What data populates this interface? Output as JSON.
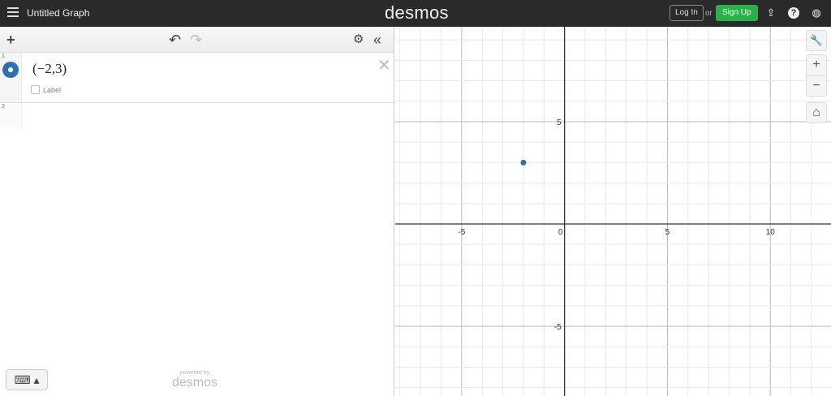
{
  "header": {
    "title": "Untitled Graph",
    "logo": "desmos",
    "login": "Log In",
    "or": "or",
    "signup": "Sign Up",
    "icons": [
      "share-icon",
      "help-icon",
      "globe-icon"
    ]
  },
  "toolbar": {
    "add": "+",
    "undo": "↶",
    "redo": "↷",
    "settings": "⚙",
    "collapse": "«"
  },
  "expressions": [
    {
      "num": "1",
      "latex": "(−2,3)",
      "label": "Label",
      "color": "#2d70b3"
    },
    {
      "num": "2",
      "latex": ""
    }
  ],
  "footer": {
    "keyboard": "⌨ ▴",
    "powered": "powered by",
    "brand": "desmos"
  },
  "graph": {
    "xrange": [
      -8.23,
      12.95
    ],
    "yrange": [
      -8.41,
      9.64
    ],
    "xticks": [
      -5,
      0,
      5,
      10
    ],
    "yticks": [
      5,
      -5
    ],
    "points": [
      {
        "x": -2,
        "y": 3,
        "color": "#2d70b3"
      }
    ],
    "buttons": {
      "wrench": "🔧",
      "zoom_in": "+",
      "zoom_out": "−",
      "home": "⌂"
    }
  }
}
